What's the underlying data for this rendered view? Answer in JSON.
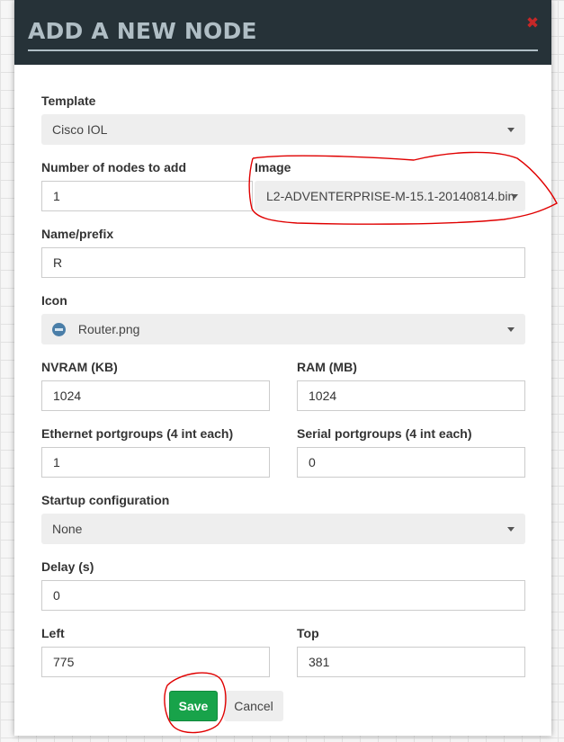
{
  "dialog": {
    "title": "ADD A NEW NODE",
    "close_icon": "close-icon"
  },
  "form": {
    "template": {
      "label": "Template",
      "value": "Cisco IOL"
    },
    "node_count": {
      "label": "Number of nodes to add",
      "value": "1"
    },
    "image": {
      "label": "Image",
      "value": "L2-ADVENTERPRISE-M-15.1-20140814.bin"
    },
    "name_prefix": {
      "label": "Name/prefix",
      "value": "R"
    },
    "icon": {
      "label": "Icon",
      "value": "Router.png",
      "icon_name": "router-icon"
    },
    "nvram": {
      "label": "NVRAM (KB)",
      "value": "1024"
    },
    "ram": {
      "label": "RAM (MB)",
      "value": "1024"
    },
    "ethernet": {
      "label": "Ethernet portgroups (4 int each)",
      "value": "1"
    },
    "serial": {
      "label": "Serial portgroups (4 int each)",
      "value": "0"
    },
    "startup_config": {
      "label": "Startup configuration",
      "value": "None"
    },
    "delay": {
      "label": "Delay (s)",
      "value": "0"
    },
    "left": {
      "label": "Left",
      "value": "775"
    },
    "top": {
      "label": "Top",
      "value": "381"
    }
  },
  "buttons": {
    "save_label": "Save",
    "cancel_label": "Cancel"
  },
  "colors": {
    "header_bg": "#263238",
    "title_color": "#b0bec5",
    "save_green": "#18a34a",
    "annotation_red": "#e00000"
  }
}
